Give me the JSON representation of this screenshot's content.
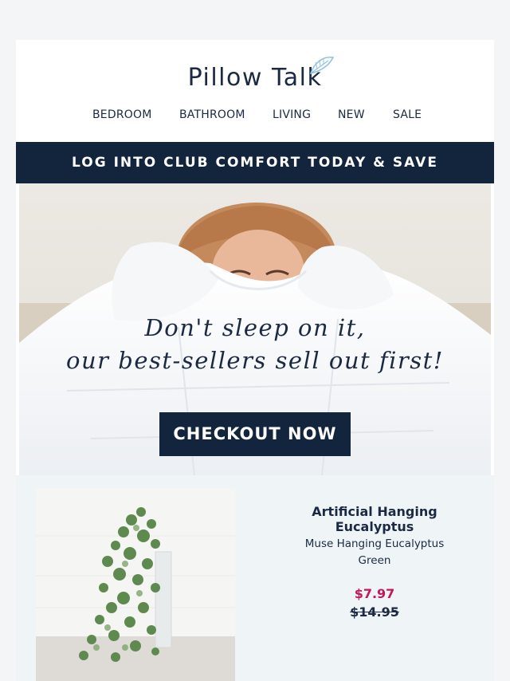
{
  "brand": {
    "name": "Pillow Talk",
    "logo_icon": "feather-icon",
    "accent": "#13243d",
    "sale_color": "#c2185b"
  },
  "nav": {
    "items": [
      "BEDROOM",
      "BATHROOM",
      "LIVING",
      "NEW",
      "SALE"
    ]
  },
  "club_banner": {
    "label": "LOG INTO CLUB COMFORT TODAY & SAVE"
  },
  "hero": {
    "headline_line1": "Don't sleep on it,",
    "headline_line2": "our best-sellers sell out first!",
    "cta_label": "CHECKOUT NOW"
  },
  "product": {
    "name": "Artificial Hanging Eucalyptus",
    "variant": "Muse Hanging Eucalyptus",
    "color": "Green",
    "sale_price": "$7.97",
    "original_price": "$14.95"
  }
}
